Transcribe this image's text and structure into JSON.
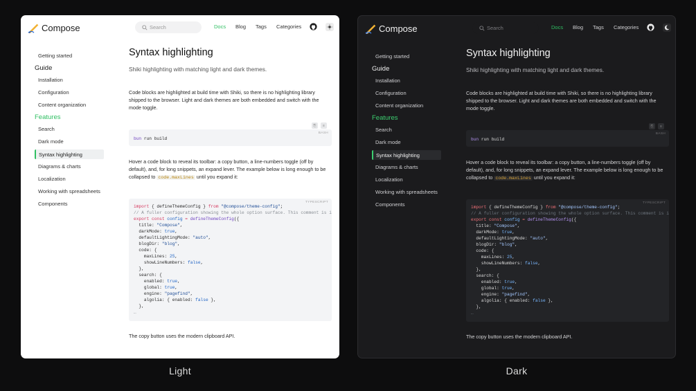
{
  "colors": {
    "accent": "#2fbf62",
    "brand_light_bg": "#ffffff",
    "brand_dark_bg": "#1b1b1d"
  },
  "brand": "Compose",
  "search_placeholder": "Search",
  "nav": {
    "docs": "Docs",
    "blog": "Blog",
    "tags": "Tags",
    "categories": "Categories"
  },
  "icons": {
    "logo": "pen-logo-icon",
    "search": "search-icon",
    "github": "github-icon",
    "theme_light": "sun-icon",
    "theme_dark": "moon-icon",
    "copy": "copy-icon",
    "line_numbers": "line-numbers-icon"
  },
  "sidebar": {
    "getting_started": "Getting started",
    "guide_label": "Guide",
    "guide_items": [
      "Installation",
      "Configuration",
      "Content organization"
    ],
    "features_label": "Features",
    "feature_items": [
      "Search",
      "Dark mode",
      "Syntax highlighting",
      "Diagrams & charts",
      "Localization",
      "Working with spreadsheets",
      "Components"
    ]
  },
  "page": {
    "title": "Syntax highlighting",
    "subtitle": "Shiki highlighting with matching light and dark themes.",
    "para1": "Code blocks are highlighted at build time with Shiki, so there is no highlighting library shipped to the browser. Light and dark themes are both embedded and switch with the mode toggle.",
    "bash_lang": "BASH",
    "bash_cmd": "bun",
    "bash_args": " run build",
    "para2_a": "Hover a code block to reveal its toolbar: a copy button, a line-numbers toggle (off by default), and, for long snippets, an expand lever. The example below is long enough to be collapsed to ",
    "para2_code": "code.maxLines",
    "para2_b": " until you expand it:",
    "ts_lang": "TYPESCRIPT",
    "para3": "The copy button uses the modern clipboard API."
  },
  "code_lines": [
    [
      [
        "kw",
        "import"
      ],
      [
        "plain",
        " { defineThemeConfig } "
      ],
      [
        "kw",
        "from"
      ],
      [
        "str",
        " \"@compose/theme-config\""
      ],
      [
        "plain",
        ";"
      ]
    ],
    [
      [
        "cm",
        "// A fuller configuration showing the whole option surface. This comment is intentionally long"
      ]
    ],
    [
      [
        "kw",
        "export const"
      ],
      [
        "plain",
        " "
      ],
      [
        "num",
        "config"
      ],
      [
        "plain",
        " "
      ],
      [
        "kw",
        "="
      ],
      [
        "plain",
        " "
      ],
      [
        "fn",
        "defineThemeConfig"
      ],
      [
        "plain",
        "({"
      ]
    ],
    [
      [
        "plain",
        "  title: "
      ],
      [
        "str",
        "\"Compose\""
      ],
      [
        "plain",
        ","
      ]
    ],
    [
      [
        "plain",
        "  darkMode: "
      ],
      [
        "num",
        "true"
      ],
      [
        "plain",
        ","
      ]
    ],
    [
      [
        "plain",
        "  defaultLightingMode: "
      ],
      [
        "str",
        "\"auto\""
      ],
      [
        "plain",
        ","
      ]
    ],
    [
      [
        "plain",
        "  blogDir: "
      ],
      [
        "str",
        "\"blog\""
      ],
      [
        "plain",
        ","
      ]
    ],
    [
      [
        "plain",
        "  code: {"
      ]
    ],
    [
      [
        "plain",
        "    maxLines: "
      ],
      [
        "num",
        "25"
      ],
      [
        "plain",
        ","
      ]
    ],
    [
      [
        "plain",
        "    showLineNumbers: "
      ],
      [
        "num",
        "false"
      ],
      [
        "plain",
        ","
      ]
    ],
    [
      [
        "plain",
        "  },"
      ]
    ],
    [
      [
        "plain",
        "  search: {"
      ]
    ],
    [
      [
        "plain",
        "    enabled: "
      ],
      [
        "num",
        "true"
      ],
      [
        "plain",
        ","
      ]
    ],
    [
      [
        "plain",
        "    global: "
      ],
      [
        "num",
        "true"
      ],
      [
        "plain",
        ","
      ]
    ],
    [
      [
        "plain",
        "    engine: "
      ],
      [
        "str",
        "\"pagefind\""
      ],
      [
        "plain",
        ","
      ]
    ],
    [
      [
        "plain",
        "    algolia: { enabled: "
      ],
      [
        "num",
        "false"
      ],
      [
        "plain",
        " },"
      ]
    ],
    [
      [
        "plain",
        "  },"
      ]
    ],
    [
      [
        "cm",
        "…"
      ]
    ]
  ],
  "captions": {
    "light": "Light",
    "dark": "Dark"
  }
}
